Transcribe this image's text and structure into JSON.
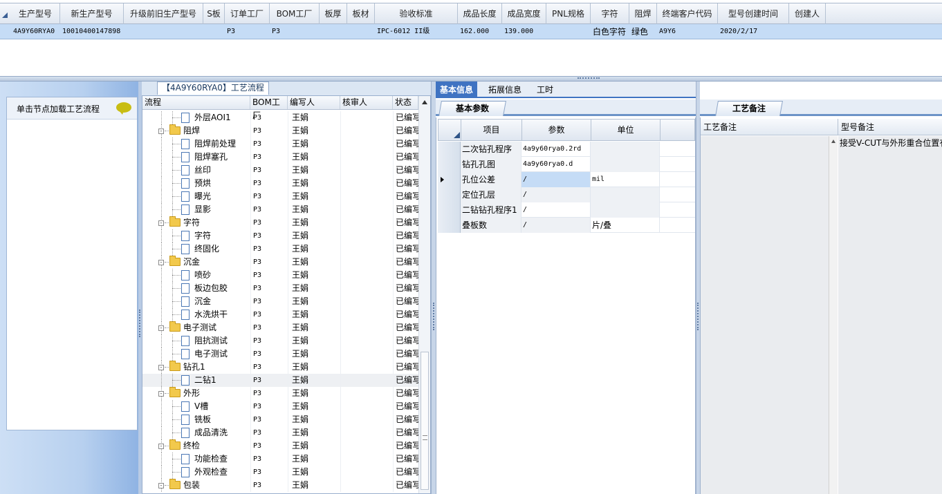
{
  "top_grid": {
    "headers": [
      "生产型号",
      "新生产型号",
      "升级前旧生产型号",
      "S板",
      "订单工厂",
      "BOM工厂",
      "板厚",
      "板材",
      "验收标准",
      "成品长度",
      "成品宽度",
      "PNL规格",
      "字符",
      "阻焊",
      "终端客户代码",
      "型号创建时间",
      "创建人"
    ],
    "row": {
      "c0": "4A9Y60RYA0",
      "c1": "10010400147898",
      "c2": "",
      "c3": "",
      "c4": "P3",
      "c5": "P3",
      "c6": "",
      "c7": "",
      "c8": "IPC-6012 II级",
      "c9": "162.000",
      "c10": "139.000",
      "c11": "",
      "c12": "白色字符",
      "c13": "绿色",
      "c14": "A9Y6",
      "c15": "2020/2/17",
      "c16": ""
    }
  },
  "left_panel": {
    "load_label": "单击节点加载工艺流程",
    "icon": "speech-bubble-icon"
  },
  "tree": {
    "title": "【4A9Y60RYA0】工艺流程",
    "headers": [
      "流程",
      "BOM工厂",
      "编写人",
      "核审人",
      "状态"
    ],
    "rows": [
      {
        "name": "外层AOI1",
        "bom": "P3",
        "author": "王娟",
        "reviewer": "",
        "status": "已编写"
      },
      {
        "name": "阻焊",
        "bom": "P3",
        "author": "王娟",
        "reviewer": "",
        "status": "已编写"
      },
      {
        "name": "阻焊前处理",
        "bom": "P3",
        "author": "王娟",
        "reviewer": "",
        "status": "已编写"
      },
      {
        "name": "阻焊塞孔",
        "bom": "P3",
        "author": "王娟",
        "reviewer": "",
        "status": "已编写"
      },
      {
        "name": "丝印",
        "bom": "P3",
        "author": "王娟",
        "reviewer": "",
        "status": "已编写"
      },
      {
        "name": "预烘",
        "bom": "P3",
        "author": "王娟",
        "reviewer": "",
        "status": "已编写"
      },
      {
        "name": "曝光",
        "bom": "P3",
        "author": "王娟",
        "reviewer": "",
        "status": "已编写"
      },
      {
        "name": "显影",
        "bom": "P3",
        "author": "王娟",
        "reviewer": "",
        "status": "已编写"
      },
      {
        "name": "字符",
        "bom": "P3",
        "author": "王娟",
        "reviewer": "",
        "status": "已编写"
      },
      {
        "name": "字符",
        "bom": "P3",
        "author": "王娟",
        "reviewer": "",
        "status": "已编写"
      },
      {
        "name": "终固化",
        "bom": "P3",
        "author": "王娟",
        "reviewer": "",
        "status": "已编写"
      },
      {
        "name": "沉金",
        "bom": "P3",
        "author": "王娟",
        "reviewer": "",
        "status": "已编写"
      },
      {
        "name": "喷砂",
        "bom": "P3",
        "author": "王娟",
        "reviewer": "",
        "status": "已编写"
      },
      {
        "name": "板边包胶",
        "bom": "P3",
        "author": "王娟",
        "reviewer": "",
        "status": "已编写"
      },
      {
        "name": "沉金",
        "bom": "P3",
        "author": "王娟",
        "reviewer": "",
        "status": "已编写"
      },
      {
        "name": "水洗烘干",
        "bom": "P3",
        "author": "王娟",
        "reviewer": "",
        "status": "已编写"
      },
      {
        "name": "电子测试",
        "bom": "P3",
        "author": "王娟",
        "reviewer": "",
        "status": "已编写"
      },
      {
        "name": "阻抗测试",
        "bom": "P3",
        "author": "王娟",
        "reviewer": "",
        "status": "已编写"
      },
      {
        "name": "电子测试",
        "bom": "P3",
        "author": "王娟",
        "reviewer": "",
        "status": "已编写"
      },
      {
        "name": "钻孔1",
        "bom": "P3",
        "author": "王娟",
        "reviewer": "",
        "status": "已编写"
      },
      {
        "name": "二钻1",
        "bom": "P3",
        "author": "王娟",
        "reviewer": "",
        "status": "已编写"
      },
      {
        "name": "外形",
        "bom": "P3",
        "author": "王娟",
        "reviewer": "",
        "status": "已编写"
      },
      {
        "name": "V槽",
        "bom": "P3",
        "author": "王娟",
        "reviewer": "",
        "status": "已编写"
      },
      {
        "name": "铣板",
        "bom": "P3",
        "author": "王娟",
        "reviewer": "",
        "status": "已编写"
      },
      {
        "name": "成品清洗",
        "bom": "P3",
        "author": "王娟",
        "reviewer": "",
        "status": "已编写"
      },
      {
        "name": "终检",
        "bom": "P3",
        "author": "王娟",
        "reviewer": "",
        "status": "已编写"
      },
      {
        "name": "功能检查",
        "bom": "P3",
        "author": "王娟",
        "reviewer": "",
        "status": "已编写"
      },
      {
        "name": "外观检查",
        "bom": "P3",
        "author": "王娟",
        "reviewer": "",
        "status": "已编写"
      },
      {
        "name": "包装",
        "bom": "P3",
        "author": "王娟",
        "reviewer": "",
        "status": "已编写"
      }
    ]
  },
  "info_tabs": [
    "基本信息",
    "拓展信息",
    "工时"
  ],
  "params": {
    "sub_tab": "基本参数",
    "headers": [
      "项目",
      "参数",
      "单位"
    ],
    "rows": [
      {
        "item": "二次钻孔程序",
        "value": "4a9y60rya0.2rd",
        "unit": ""
      },
      {
        "item": "钻孔孔图",
        "value": "4a9y60rya0.d",
        "unit": ""
      },
      {
        "item": "孔位公差",
        "value": "/",
        "unit": "mil"
      },
      {
        "item": "定位孔层",
        "value": "/",
        "unit": ""
      },
      {
        "item": "二钻钻孔程序1",
        "value": "/",
        "unit": ""
      },
      {
        "item": "叠板数",
        "value": "/",
        "unit": "片/叠"
      }
    ]
  },
  "remarks": {
    "tab": "工艺备注",
    "col_process": "工艺备注",
    "col_model": "型号备注",
    "model_text": "接受V-CUT与外形重合位置有"
  }
}
